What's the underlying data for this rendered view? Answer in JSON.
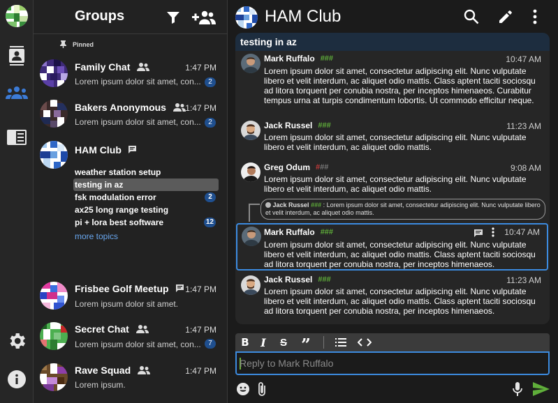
{
  "rail": {
    "items": [
      "account-avatar",
      "contacts-icon",
      "groups-icon",
      "directory-icon",
      "settings-icon",
      "info-icon"
    ],
    "accent": "#3c7bd6"
  },
  "groups": {
    "title": "Groups",
    "pinned_label": "Pinned",
    "list": [
      {
        "name": "Family Chat",
        "time": "1:47 PM",
        "preview": "Lorem ipsum dolor sit amet, con...",
        "badge": "2"
      },
      {
        "name": "Bakers Anonymous",
        "time": "1:47 PM",
        "preview": "Lorem ipsum dolor sit amet, con...",
        "badge": "2"
      },
      {
        "name": "HAM Club"
      },
      {
        "name": "Frisbee Golf Meetup",
        "time": "1:47 PM",
        "preview": "Lorem ipsum dolor sit amet."
      },
      {
        "name": "Secret Chat",
        "time": "1:47 PM",
        "preview": "Lorem ipsum dolor sit amet, con...",
        "badge": "7"
      },
      {
        "name": "Rave Squad",
        "time": "1:47 PM",
        "preview": "Lorem ipsum."
      }
    ],
    "topics": [
      {
        "label": "weather station setup"
      },
      {
        "label": "testing in az"
      },
      {
        "label": "fsk modulation error",
        "badge": "2"
      },
      {
        "label": "ax25 long range testing"
      },
      {
        "label": "pi + lora best software",
        "badge": "12"
      }
    ],
    "more_topics": "more topics"
  },
  "chat": {
    "title": "HAM Club",
    "thread_title": "testing in az",
    "messages": [
      {
        "name": "Mark Ruffalo",
        "hashes": "###",
        "time": "10:47 AM",
        "body": "Lorem ipsum dolor sit amet, consectetur adipiscing elit. Nunc vulputate libero et velit interdum, ac aliquet odio mattis. Class aptent taciti sociosqu ad litora torquent per conubia nostra, per inceptos himenaeos. Curabitur tempus urna at turpis condimentum lobortis. Ut commodo efficitur neque."
      },
      {
        "name": "Jack Russel",
        "hashes": "###",
        "time": "11:23 AM",
        "body": "Lorem ipsum dolor sit amet, consectetur adipiscing elit. Nunc vulputate libero et velit interdum, ac aliquet odio mattis."
      },
      {
        "name": "Greg Odum",
        "hashes": "###",
        "time": "9:08 AM",
        "body": "Lorem ipsum dolor sit amet, consectetur adipiscing elit. Nunc vulputate libero et velit interdum, ac aliquet odio mattis."
      },
      {
        "name": "Mark Ruffalo",
        "hashes": "###",
        "time": "10:47 AM",
        "body": "Lorem ipsum dolor sit amet, consectetur adipiscing elit. Nunc vulputate libero et velit interdum, ac aliquet odio mattis. Class aptent taciti sociosqu ad litora torquent per conubia nostra, per inceptos himenaeos."
      },
      {
        "name": "Jack Russel",
        "hashes": "###",
        "time": "11:23 AM",
        "body": "Lorem ipsum dolor sit amet, consectetur adipiscing elit. Nunc vulputate libero et velit interdum, ac aliquet odio mattis. Class aptent taciti sociosqu ad litora torquent per conubia nostra, per inceptos himenaeos."
      }
    ],
    "reply_quote": {
      "name": "Jack Russel",
      "hashes": "###",
      "text": "Lorem ipsum dolor sit amet, consectetur adipiscing elit. Nunc vulputate libero et velit interdum, ac aliquet odio mattis."
    },
    "composer": {
      "placeholder": "Reply to Mark Ruffalo",
      "toolbar": [
        "bold-icon",
        "italic-icon",
        "strikethrough-icon",
        "quote-icon",
        "list-icon",
        "code-icon"
      ]
    },
    "colors": {
      "hash_green": "#5fae3a",
      "hash_red": "#c23b3b",
      "send_green": "#5fae3a",
      "focus_blue": "#3c8be0"
    }
  }
}
